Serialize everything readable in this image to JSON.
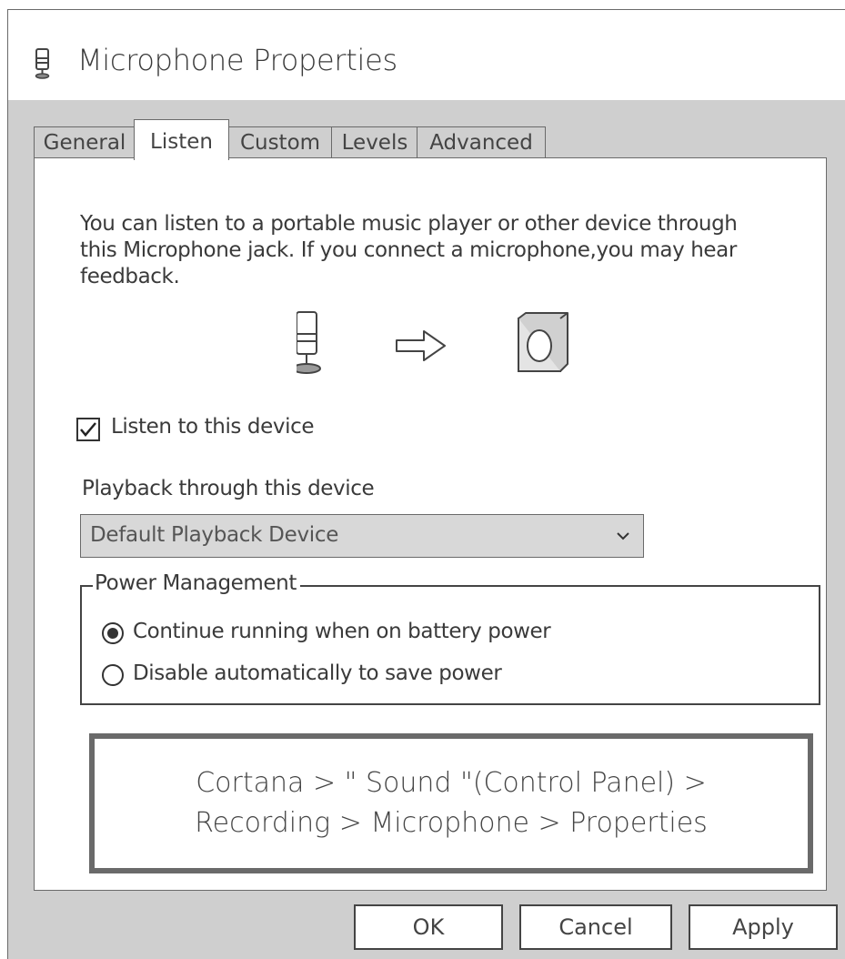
{
  "window": {
    "title": "Microphone Properties",
    "title_icon": "microphone-icon"
  },
  "tabs": [
    {
      "label": "General",
      "active": false
    },
    {
      "label": "Listen",
      "active": true
    },
    {
      "label": "Custom",
      "active": false
    },
    {
      "label": "Levels",
      "active": false
    },
    {
      "label": "Advanced",
      "active": false
    }
  ],
  "listen": {
    "description_lines": [
      "You can listen to a portable music player or other device through",
      "this Microphone jack. If you connect a microphone,you may hear",
      "feedback."
    ],
    "illustration": [
      "microphone-icon",
      "arrow-right-icon",
      "speaker-icon"
    ],
    "listen_checkbox": {
      "label": "Listen to this device",
      "checked": true
    },
    "playback_label": "Playback through this device",
    "playback_select": {
      "value": "Default Playback Device"
    },
    "power_management": {
      "legend": "Power Management",
      "options": [
        {
          "label": "Continue running when on battery power",
          "selected": true
        },
        {
          "label": "Disable automatically to save power",
          "selected": false
        }
      ]
    }
  },
  "callout": {
    "lines": [
      "Cortana > \" Sound \"(Control Panel) >",
      "Recording > Microphone > Properties"
    ]
  },
  "buttons": {
    "ok": "OK",
    "cancel": "Cancel",
    "apply": "Apply"
  },
  "colors": {
    "window_background": "#cfcfcf",
    "panel_background": "#ffffff",
    "border": "#6a6a6a",
    "text": "#3a3a3a"
  }
}
